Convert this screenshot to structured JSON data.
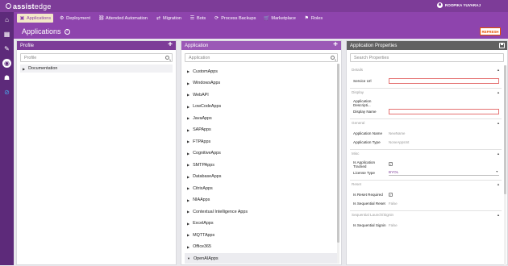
{
  "brand": {
    "logo_part1": "assist",
    "logo_part2": "edge"
  },
  "user": {
    "name": "ROOPIKA YUVARAJ"
  },
  "rail": {
    "items": [
      {
        "name": "home-icon",
        "glyph": "⌂"
      },
      {
        "name": "grid-icon",
        "glyph": "▦"
      },
      {
        "name": "pencil-icon",
        "glyph": "✎"
      },
      {
        "name": "target-icon",
        "glyph": "◉"
      },
      {
        "name": "users-icon",
        "glyph": "☗"
      },
      {
        "name": "compass-icon",
        "glyph": "⊘"
      }
    ]
  },
  "nav": {
    "tabs": [
      {
        "label": "Applications",
        "icon": "▣",
        "active": true
      },
      {
        "label": "Deployment",
        "icon": "⚙"
      },
      {
        "label": "Attended Automation",
        "icon": "⛓"
      },
      {
        "label": "Migration",
        "icon": "⇄"
      },
      {
        "label": "Bots",
        "icon": "☰"
      },
      {
        "label": "Process Backups",
        "icon": "⟳"
      },
      {
        "label": "Marketplace",
        "icon": "🛒"
      },
      {
        "label": "Roles",
        "icon": "⚑"
      }
    ]
  },
  "page": {
    "title": "Applications",
    "help": "?",
    "refresh_label": "REFRESH"
  },
  "profile_panel": {
    "header": "Profile",
    "add": "+",
    "search_placeholder": "Profile",
    "tree": [
      {
        "label": "Documentation"
      }
    ]
  },
  "application_panel": {
    "header": "Application",
    "add": "+",
    "search_placeholder": "Application",
    "items": [
      "CustomApps",
      "WindowsApps",
      "WebAPI",
      "LowCodeApps",
      "JavaApps",
      "SAPApps",
      "FTPApps",
      "CognitiveApps",
      "SMTPApps",
      "DatabaseApps",
      "CitrixApps",
      "NIAApps",
      "Contextual Intelligence Apps",
      "ExcelApps",
      "MQTTApps",
      "Office365",
      "OpenAIApps"
    ]
  },
  "properties_panel": {
    "header": "Application Properties",
    "search_placeholder": "Search Properties",
    "sections": {
      "details": {
        "title": "Details",
        "service_url": "Service Url"
      },
      "display": {
        "title": "Display",
        "app_desc": "Application Descripti...",
        "display_name": "Display Name"
      },
      "general": {
        "title": "General",
        "app_name": "Application Name",
        "app_name_value": "NewName",
        "app_type": "Application Type",
        "app_type_value": "NoneAppsInt"
      },
      "misc": {
        "title": "Misc",
        "is_tracked": "Is Application Tracked",
        "license_type": "License Type",
        "license_value": "BYOL"
      },
      "reset": {
        "title": "Reset",
        "is_reset": "Is Reset Required",
        "is_seq_reset": "Is Sequential Reset",
        "is_seq_reset_value": "False"
      },
      "seq_launch": {
        "title": "Sequential Launch/Signin",
        "is_seq_signin": "Is Sequential Signin",
        "is_seq_signin_value": "False"
      }
    }
  },
  "colors": {
    "primary": "#8e44ad",
    "profile_header": "#7d3c98",
    "app_header": "#9b59b6",
    "props_header": "#616161",
    "accent": "#e65100"
  }
}
